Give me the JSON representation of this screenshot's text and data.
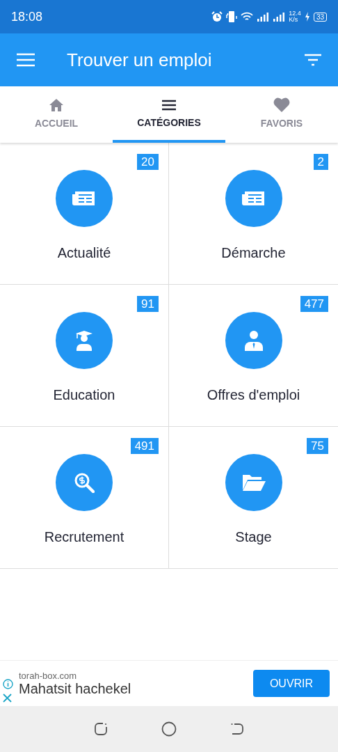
{
  "status_bar": {
    "time": "18:08",
    "speed": "12.4",
    "speed_unit": "K/s",
    "battery": "33"
  },
  "app_bar": {
    "title": "Trouver un emploi"
  },
  "tabs": [
    {
      "label": "ACCUEIL",
      "kind": "home",
      "selected": false
    },
    {
      "label": "CATÉGORIES",
      "kind": "list",
      "selected": true
    },
    {
      "label": "FAVORIS",
      "kind": "heart",
      "selected": false
    }
  ],
  "categories": [
    {
      "name": "Actualité",
      "count": "20",
      "kind": "news"
    },
    {
      "name": "Démarche",
      "count": "2",
      "kind": "news"
    },
    {
      "name": "Education",
      "count": "91",
      "kind": "graduate"
    },
    {
      "name": "Offres d'emploi",
      "count": "477",
      "kind": "person"
    },
    {
      "name": "Recrutement",
      "count": "491",
      "kind": "search"
    },
    {
      "name": "Stage",
      "count": "75",
      "kind": "folder"
    }
  ],
  "ad": {
    "domain": "torah-box.com",
    "headline": "Mahatsit hachekel",
    "button": "OUVRIR"
  }
}
